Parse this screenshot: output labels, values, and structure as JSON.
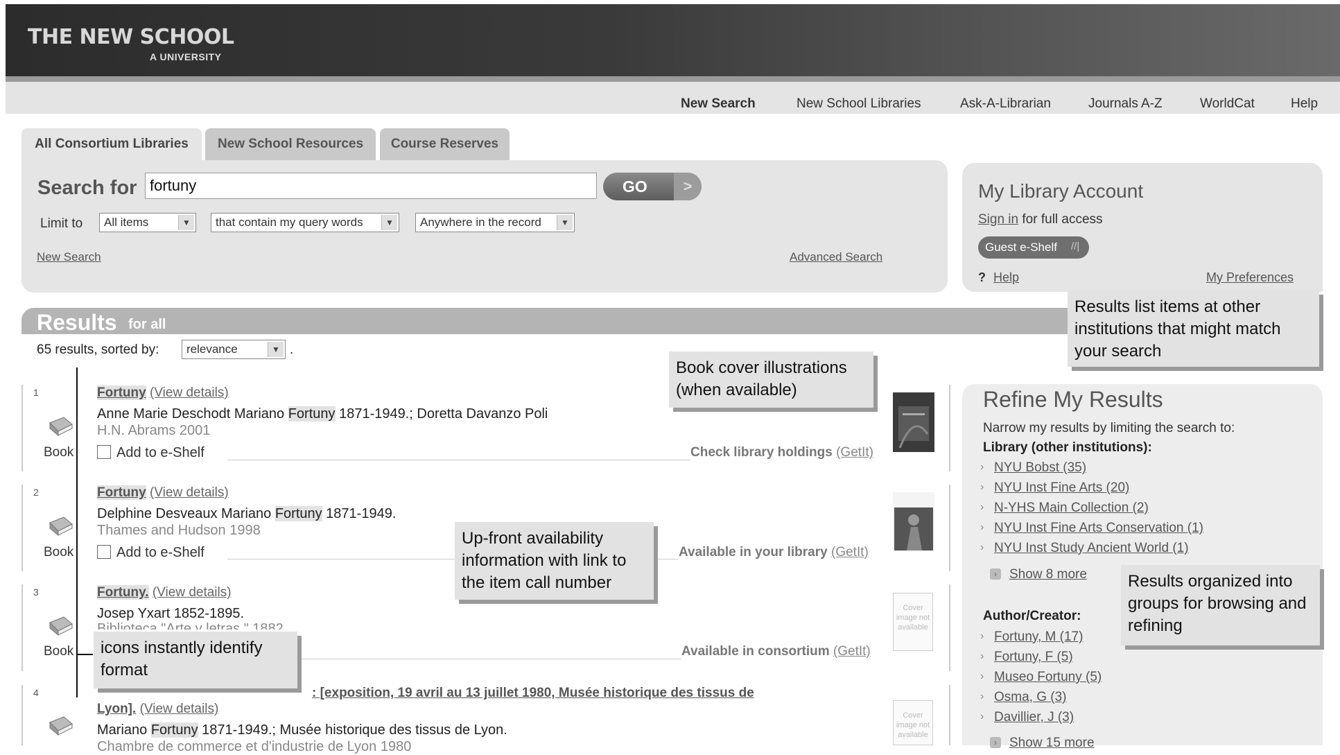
{
  "header": {
    "logo": "THE NEW SCHOOL",
    "logo_sub": "A UNIVERSITY"
  },
  "topnav": {
    "items": [
      "New Search",
      "New School Libraries",
      "Ask-A-Librarian",
      "Journals A-Z",
      "WorldCat",
      "Help"
    ]
  },
  "tabs": [
    "All Consortium Libraries",
    "New School Resources",
    "Course Reserves"
  ],
  "search": {
    "label": "Search for",
    "value": "fortuny",
    "go_label": "GO",
    "go_arrow": ">",
    "limit_label": "Limit to",
    "limit_items": "All items",
    "limit_words": "that contain my query words",
    "limit_where": "Anywhere in the record",
    "new_search": "New Search",
    "advanced_search": "Advanced Search"
  },
  "account": {
    "title": "My Library Account",
    "sign_in": "Sign in",
    "sign_in_suffix": "for full access",
    "guest_eshelf": "Guest e-Shelf",
    "help_q": "?",
    "help": "Help",
    "preferences": "My Preferences"
  },
  "results": {
    "title": "Results",
    "for": "for",
    "scope": "all",
    "count_text": "65 results, sorted by:",
    "sort_value": "relevance",
    "sort_suffix": ".",
    "items": [
      {
        "num": "1",
        "title": "Fortuny",
        "view": "(View details)",
        "line_a": "Anne Marie Deschodt Mariano ",
        "line_hl": "Fortuny",
        "line_b": " 1871-1949.; Doretta Davanzo Poli",
        "sub": "H.N. Abrams 2001",
        "format": "Book",
        "shelf": "Add to e-Shelf",
        "status": "Check library holdings",
        "getit": "(GetIt)"
      },
      {
        "num": "2",
        "title": "Fortuny",
        "view": "(View details)",
        "line_a": "Delphine Desveaux Mariano ",
        "line_hl": "Fortuny",
        "line_b": " 1871-1949.",
        "sub": "Thames and Hudson 1998",
        "format": "Book",
        "shelf": "Add to e-Shelf",
        "status": "Available in your library",
        "getit": "(GetIt)"
      },
      {
        "num": "3",
        "title": "Fortuny.",
        "view": "(View details)",
        "line_a": "Josep Yxart 1852-1895.",
        "line_hl": "",
        "line_b": "",
        "sub": "Biblioteca \"Arte y letras,\" 1882",
        "format": "Book",
        "shelf": "",
        "status": "Available in consortium",
        "getit": "(GetIt)"
      },
      {
        "num": "4",
        "title_tail": ": [exposition, 19 avril au 13 juillet 1980, Musée historique des tissus de",
        "title_line2": "Lyon].",
        "view": "(View details)",
        "line_a": "Mariano ",
        "line_hl": "Fortuny",
        "line_b": " 1871-1949.; Musée historique des tissus de Lyon.",
        "sub": "Chambre de commerce et d'industrie de Lyon 1980"
      }
    ],
    "cover_na": "Cover image not available"
  },
  "refine": {
    "title": "Refine My Results",
    "intro": "Narrow my results by limiting the search to:",
    "library_heading": "Library (other institutions):",
    "library": [
      "NYU Bobst (35)",
      "NYU Inst Fine Arts (20)",
      "N-YHS Main Collection (2)",
      "NYU Inst Fine Arts Conservation (1)",
      "NYU Inst Study Ancient World (1)"
    ],
    "library_more": "Show 8 more",
    "author_heading": "Author/Creator:",
    "author": [
      "Fortuny, M (17)",
      "Fortuny, F (5)",
      "Museo Fortuny (5)",
      "Osma, G (3)",
      "Davillier, J (3)"
    ],
    "author_more": "Show 15 more"
  },
  "callouts": {
    "covers": "Book cover illustrations (when available)",
    "other_institutions": "Results list items at other institutions that might match your search",
    "availability": "Up-front availability information with link to the item call number",
    "icons": "icons instantly identify format",
    "groups": "Results organized into groups for browsing and refining"
  },
  "colors": {
    "header_dark": "#2c2c2c",
    "panel": "#e5e5e5",
    "results_bar": "#b4b4b4",
    "callout_bg": "#e2e2e2"
  }
}
